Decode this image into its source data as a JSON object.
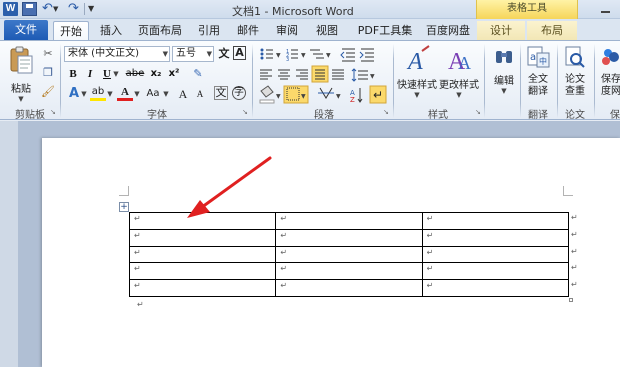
{
  "window": {
    "title": "文档1 - Microsoft Word",
    "app_icon": "W",
    "context_tab_group": "表格工具"
  },
  "tabs": [
    {
      "label": "文件"
    },
    {
      "label": "开始"
    },
    {
      "label": "插入"
    },
    {
      "label": "页面布局"
    },
    {
      "label": "引用"
    },
    {
      "label": "邮件"
    },
    {
      "label": "审阅"
    },
    {
      "label": "视图"
    },
    {
      "label": "PDF工具集"
    },
    {
      "label": "百度网盘"
    },
    {
      "label": "设计"
    },
    {
      "label": "布局"
    }
  ],
  "ribbon": {
    "clipboard": {
      "label": "剪贴板",
      "paste_label": "粘贴"
    },
    "font": {
      "label": "字体",
      "font_name": "宋体 (中文正文)",
      "font_size": "五号",
      "bold": "B",
      "italic": "I",
      "underline": "U",
      "strikethrough": "abe",
      "subscript": "x₂",
      "superscript": "x²",
      "grow": "A",
      "shrink": "A",
      "change_case": "Aa",
      "wen_char": "文",
      "enclose_char": "字",
      "border_char": "A",
      "font_color_letter": "A",
      "highlight_letter": "ab"
    },
    "paragraph": {
      "label": "段落"
    },
    "styles": {
      "label": "样式",
      "quick_styles": "快速样式",
      "change_styles": "更改样式"
    },
    "editing": {
      "label": "编辑"
    },
    "translate": {
      "label": "翻译",
      "full_text": "全文\n翻译",
      "full_text_line1": "全文",
      "full_text_line2": "翻译"
    },
    "paper": {
      "label": "论文",
      "check_line1": "论文",
      "check_line2": "查重"
    },
    "save": {
      "label": "保",
      "line1": "保存",
      "line2": "度网"
    }
  },
  "document": {
    "table": {
      "rows": 5,
      "cols": 3,
      "cell_mark": "↵"
    },
    "paragraph_mark": "↵"
  },
  "colors": {
    "accent": "#2b5fab",
    "file_tab": "#1e5bb5",
    "context_tab": "#f6d55a",
    "annotation_arrow": "#e02020"
  }
}
